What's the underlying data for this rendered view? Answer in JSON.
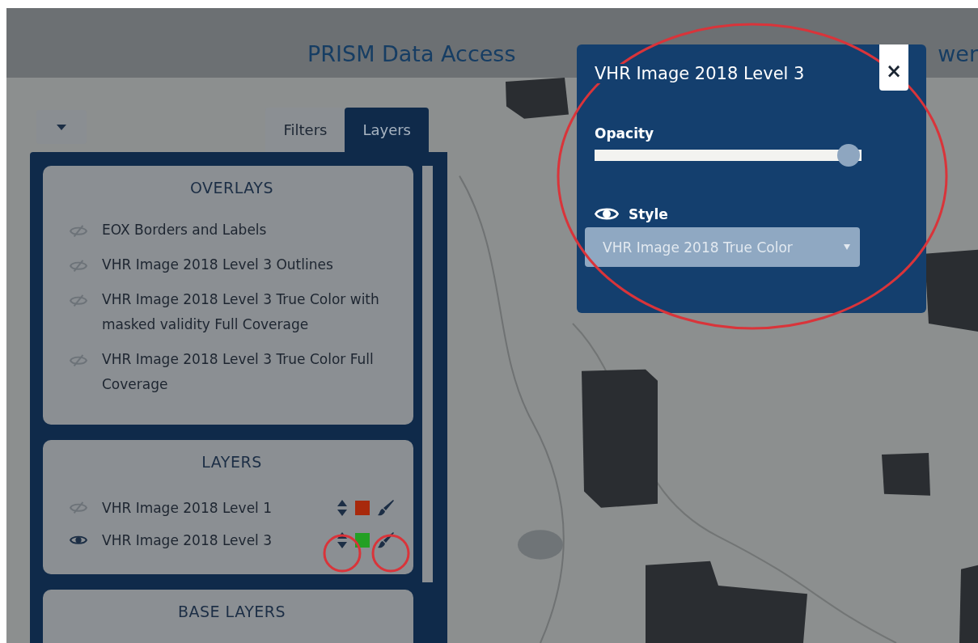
{
  "header": {
    "title": "PRISM Data Access",
    "title_tail": "wer"
  },
  "panel": {
    "tabs": [
      {
        "label": "Filters",
        "selected": false
      },
      {
        "label": "Layers",
        "selected": true
      }
    ],
    "sections": [
      {
        "kind": "overlays",
        "title": "OVERLAYS",
        "items": [
          {
            "label": "EOX Borders and Labels",
            "visible": false
          },
          {
            "label": "VHR Image 2018 Level 3 Outlines",
            "visible": false
          },
          {
            "label": "VHR Image 2018 Level 3 True Color with masked validity Full Coverage",
            "visible": false
          },
          {
            "label": "VHR Image 2018 Level 3 True Color Full Coverage",
            "visible": false
          }
        ]
      },
      {
        "kind": "layers",
        "title": "LAYERS",
        "items": [
          {
            "label": "VHR Image 2018 Level 1",
            "visible": false,
            "color": "#a8290c"
          },
          {
            "label": "VHR Image 2018 Level 3",
            "visible": true,
            "color": "#23a024"
          }
        ]
      },
      {
        "kind": "base",
        "title": "BASE LAYERS"
      }
    ]
  },
  "popup": {
    "title": "VHR Image 2018 Level 3",
    "close": "×",
    "opacity": {
      "label": "Opacity",
      "level": 0.95
    },
    "style": {
      "label": "Style",
      "visible": true,
      "value": "VHR Image 2018 True Color"
    }
  }
}
